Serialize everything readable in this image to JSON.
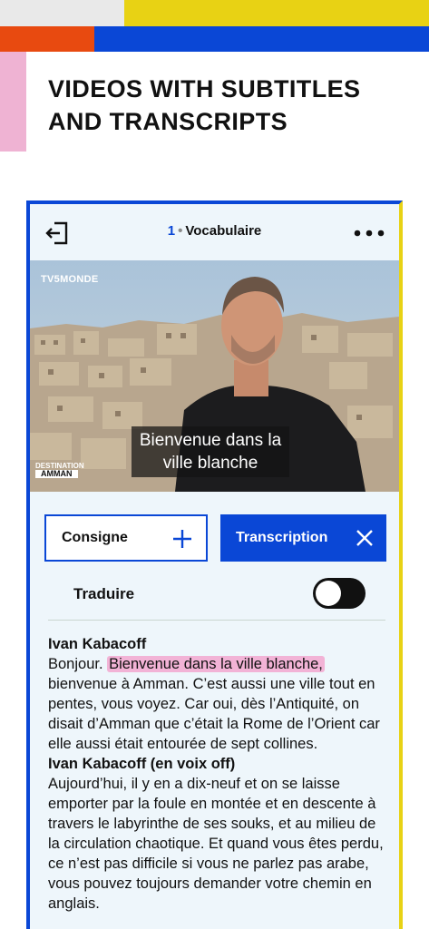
{
  "headline": {
    "line1": "VIDEOS WITH SUBTITLES",
    "line2": "AND TRANSCRIPTS"
  },
  "app": {
    "lesson_number": "1",
    "lesson_title": "Vocabulaire",
    "video": {
      "channel_logo": "TV5MONDE",
      "series_logo_top": "DESTINATION",
      "series_logo_bottom": "AMMAN",
      "subtitle": "Bienvenue dans la ville blanche"
    },
    "buttons": {
      "consigne": "Consigne",
      "transcription": "Transcription"
    },
    "translate": {
      "label": "Traduire",
      "enabled": false
    },
    "transcript": {
      "speaker1": "Ivan Kabacoff",
      "p1_before": "Bonjour.",
      "p1_highlight": "Bienvenue dans la ville blanche,",
      "p1_after": "bienvenue à Amman. C’est aussi une ville tout en pentes, vous voyez. Car oui, dès l’Antiquité, on disait d’Amman que c’était la Rome de l’Orient car elle aussi était entourée de sept collines.",
      "speaker2": "Ivan Kabacoff (en voix off)",
      "p2": "Aujourd’hui, il y en a dix-neuf et on se laisse emporter par la foule en montée et en descente à travers le labyrinthe de ses souks, et au milieu de la circulation chaotique. Et quand vous êtes perdu, ce n’est pas difficile si vous ne parlez pas arabe, vous pouvez toujours demander votre chemin en anglais."
    },
    "icons": {
      "exit": "exit-icon",
      "more": "more-dots-icon",
      "expand": "plus-icon",
      "close": "close-icon"
    },
    "colors": {
      "accent_blue": "#0a47d6",
      "yellow": "#e8d214",
      "orange": "#e84a10",
      "pink": "#efb3d3",
      "highlight": "#f2b3d6"
    }
  }
}
